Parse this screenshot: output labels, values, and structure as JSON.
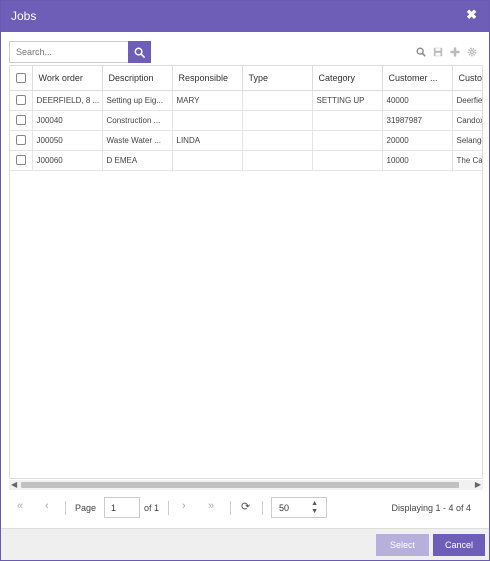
{
  "dialog": {
    "title": "Jobs",
    "close_glyph": "✖"
  },
  "search": {
    "placeholder": "Search..."
  },
  "icons": {
    "search": "search-icon",
    "save": "save-icon",
    "add": "plus-icon",
    "settings": "gear-icon"
  },
  "colors": {
    "accent": "#6e5eb8",
    "accent_disabled": "#b8b0dc"
  },
  "table": {
    "columns": [
      "Work order",
      "Description",
      "Responsible",
      "Type",
      "Category",
      "Customer ...",
      "Custo"
    ],
    "rows": [
      [
        "DEERFIELD, 8 ...",
        "Setting up Eig...",
        "MARY",
        "",
        "SETTING UP",
        "40000",
        "Deerfie"
      ],
      [
        "J00040",
        "Construction ...",
        "",
        "",
        "",
        "31987987",
        "Candox"
      ],
      [
        "J00050",
        "Waste Water ...",
        "LINDA",
        "",
        "",
        "20000",
        "Selangc"
      ],
      [
        "J00060",
        "D EMEA",
        "",
        "",
        "",
        "10000",
        "The Ca"
      ]
    ]
  },
  "pager": {
    "first": "«",
    "prev": "‹",
    "page_label": "Page",
    "page_value": "1",
    "of_label": "of 1",
    "next": "›",
    "last": "»",
    "refresh": "⟳",
    "page_size": "50",
    "display_info": "Displaying 1 - 4 of 4"
  },
  "footer": {
    "select_label": "Select",
    "cancel_label": "Cancel"
  }
}
